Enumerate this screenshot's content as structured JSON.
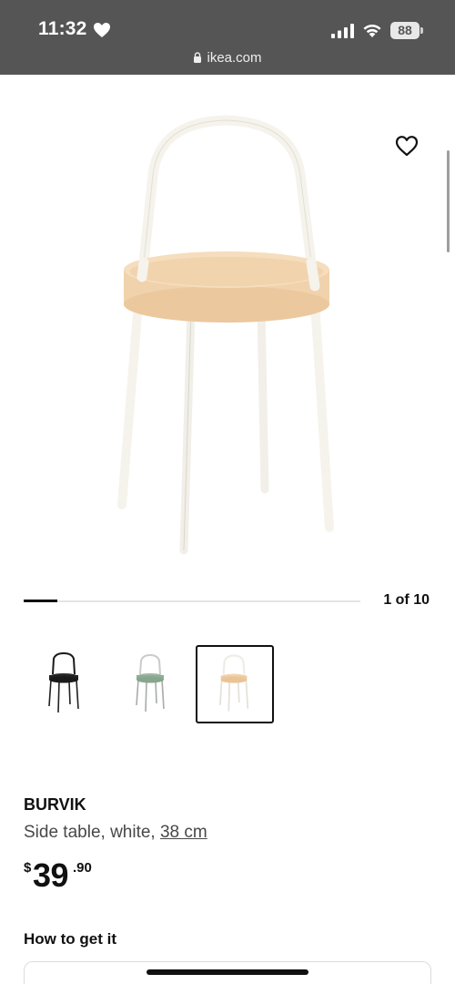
{
  "status_bar": {
    "time": "11:32",
    "battery": "88",
    "icons": [
      "heart-icon",
      "signal-icon",
      "wifi-icon",
      "battery-icon"
    ]
  },
  "address_bar": {
    "domain": "ikea.com",
    "icon": "lock-icon"
  },
  "gallery": {
    "favorite_icon": "heart-outline-icon",
    "counter": "1 of 10",
    "progress": 0.1,
    "thumbnails": [
      {
        "variant": "black",
        "selected": false
      },
      {
        "variant": "green",
        "selected": false
      },
      {
        "variant": "white/birch",
        "selected": true
      }
    ]
  },
  "product": {
    "name": "BURVIK",
    "description": "Side table, white, ",
    "size": "38 cm",
    "price": {
      "currency": "$",
      "integer": "39",
      "decimal": ".90"
    }
  },
  "sections": {
    "how_to_get_it": "How to get it"
  },
  "colors": {
    "topbar": "#555555",
    "tabletop": "#efcfa8",
    "frame": "#f7f5ef"
  }
}
